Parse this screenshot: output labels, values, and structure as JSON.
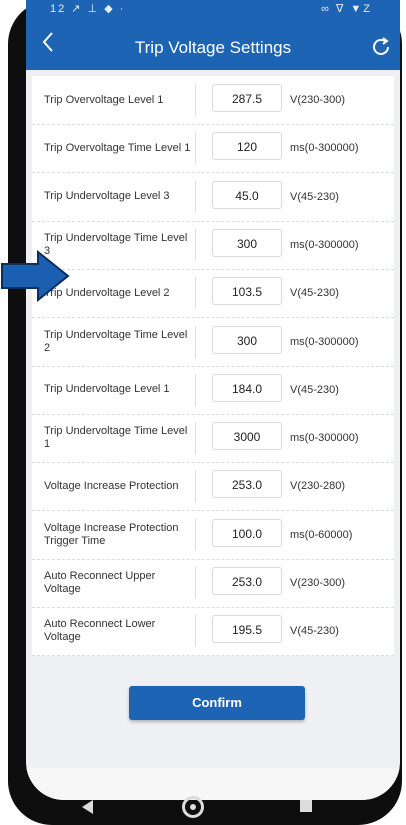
{
  "status_bar": {
    "left": "12 ↗ ⊥ ◆ ·",
    "right": "∞ ∇ ▼Z"
  },
  "header": {
    "title": "Trip Voltage Settings"
  },
  "icons": {
    "back": "chevron-left-icon",
    "refresh": "refresh-icon"
  },
  "rows": [
    {
      "label": "Trip Overvoltage Level 1",
      "value": "287.5",
      "unit": "V(230-300)"
    },
    {
      "label": "Trip Overvoltage Time Level 1",
      "value": "120",
      "unit": "ms(0-300000)"
    },
    {
      "label": "Trip Undervoltage Level 3",
      "value": "45.0",
      "unit": "V(45-230)"
    },
    {
      "label": "Trip Undervoltage Time Level 3",
      "value": "300",
      "unit": "ms(0-300000)"
    },
    {
      "label": "Trip Undervoltage Level 2",
      "value": "103.5",
      "unit": "V(45-230)"
    },
    {
      "label": "Trip Undervoltage Time Level 2",
      "value": "300",
      "unit": "ms(0-300000)"
    },
    {
      "label": "Trip Undervoltage Level 1",
      "value": "184.0",
      "unit": "V(45-230)"
    },
    {
      "label": "Trip Undervoltage Time Level 1",
      "value": "3000",
      "unit": "ms(0-300000)"
    },
    {
      "label": "Voltage Increase Protection",
      "value": "253.0",
      "unit": "V(230-280)"
    },
    {
      "label": "Voltage Increase Protection Trigger Time",
      "value": "100.0",
      "unit": "ms(0-60000)"
    },
    {
      "label": "Auto Reconnect Upper Voltage",
      "value": "253.0",
      "unit": "V(230-300)"
    },
    {
      "label": "Auto Reconnect Lower Voltage",
      "value": "195.5",
      "unit": "V(45-230)"
    }
  ],
  "confirm_label": "Confirm",
  "colors": {
    "accent": "#1d64b5",
    "background": "#eef0f3"
  }
}
